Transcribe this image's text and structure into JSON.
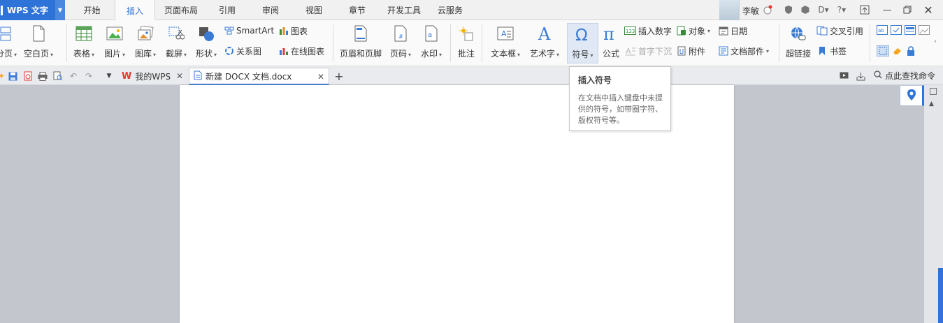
{
  "app": {
    "title": "WPS 文字",
    "colors": {
      "accent": "#2d73d8",
      "menubar_bg": "#f1f1f1",
      "ribbon_bg": "#fafafa"
    }
  },
  "menu_tabs": [
    {
      "label": "开始"
    },
    {
      "label": "插入",
      "active": true
    },
    {
      "label": "页面布局"
    },
    {
      "label": "引用"
    },
    {
      "label": "审阅"
    },
    {
      "label": "视图"
    },
    {
      "label": "章节"
    },
    {
      "label": "开发工具"
    },
    {
      "label": "云服务"
    }
  ],
  "user": {
    "name": "李敏"
  },
  "ribbon": {
    "page_break": "分页",
    "blank_page": "空白页",
    "table": "表格",
    "picture": "图片",
    "gallery": "图库",
    "screenshot": "截屏",
    "shapes": "形状",
    "smartart": "SmartArt",
    "chart": "图表",
    "relation_chart": "关系图",
    "online_chart": "在线图表",
    "header_footer": "页眉和页脚",
    "page_number": "页码",
    "watermark": "水印",
    "comment": "批注",
    "textbox": "文本框",
    "wordart": "艺术字",
    "symbol": "符号",
    "formula": "公式",
    "insert_number": "插入数字",
    "drop_cap": "首字下沉",
    "object": "对象",
    "attachment": "附件",
    "date": "日期",
    "doc_parts": "文档部件",
    "hyperlink": "超链接",
    "cross_ref": "交叉引用",
    "bookmark": "书签"
  },
  "tabs": {
    "home_tab": "我的WPS",
    "doc_tab": "新建 DOCX 文档.docx",
    "search_cmd": "点此查找命令"
  },
  "tooltip": {
    "title": "插入符号",
    "body": "在文档中插入键盘中未提供的符号，如带圈字符、版权符号等。"
  }
}
